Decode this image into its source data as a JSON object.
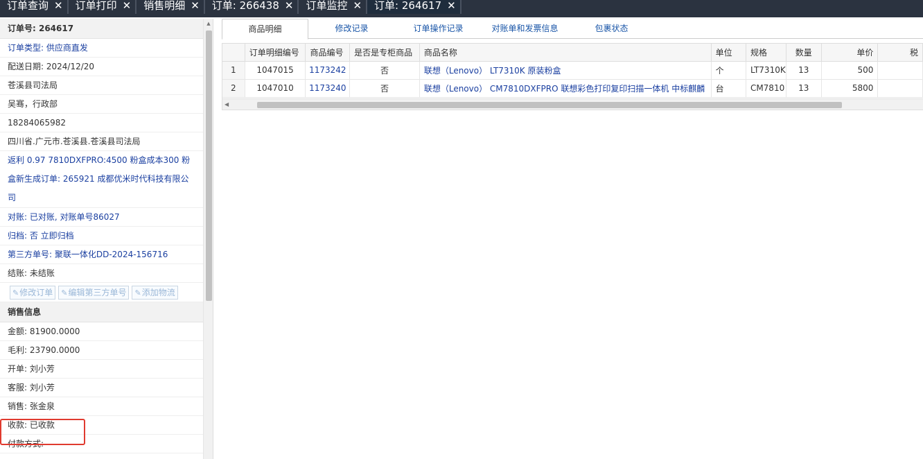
{
  "top_tabs": [
    {
      "label": "订单查询"
    },
    {
      "label": "订单打印"
    },
    {
      "label": "销售明细"
    },
    {
      "label": "订单: 266438"
    },
    {
      "label": "订单监控"
    },
    {
      "label": "订单: 264617"
    }
  ],
  "close_glyph": "✕",
  "order": {
    "header": "订单号: 264617",
    "type": "订单类型: 供应商直发",
    "delivery_date": "配送日期: 2024/12/20",
    "customer": "苍溪县司法局",
    "contact": "吴骞，行政部",
    "phone": "18284065982",
    "address": "四川省.广元市.苍溪县.苍溪县司法局",
    "remark": "返利 0.97 7810DXFPRO:4500 粉盒成本300 粉盒新生成订单: 265921 成都优米时代科技有限公司",
    "reconcile": "对账: 已对账, 对账单号86027",
    "archive": "归档: 否 立即归档",
    "third_party": "第三方单号: 聚联一体化DD-2024-156716",
    "settle": "结账: 未结账",
    "buttons": {
      "edit_order": "修改订单",
      "edit_third": "编辑第三方单号",
      "add_logistics": "添加物流"
    }
  },
  "sales": {
    "header": "销售信息",
    "amount": "金额: 81900.0000",
    "profit": "毛利: 23790.0000",
    "opener": "开单: 刘小芳",
    "service": "客服: 刘小芳",
    "salesman": "销售: 张金泉",
    "payment_status": "收款: 已收款",
    "payment_method": "付款方式:"
  },
  "sub_tabs": [
    "商品明细",
    "修改记录",
    "订单操作记录",
    "对账单和发票信息",
    "包裹状态"
  ],
  "table": {
    "headers": [
      "订单明细编号",
      "商品编号",
      "是否是专柜商品",
      "商品名称",
      "单位",
      "规格",
      "数量",
      "单价",
      "税"
    ],
    "rows": [
      {
        "idx": "1",
        "detail_id": "1047015",
        "sku": "1173242",
        "counter": "否",
        "name": "联想（Lenovo） LT7310K 原装粉盒",
        "unit": "个",
        "spec": "LT7310K",
        "qty": "13",
        "price": "500"
      },
      {
        "idx": "2",
        "detail_id": "1047010",
        "sku": "1173240",
        "counter": "否",
        "name": "联想（Lenovo） CM7810DXFPRO 联想彩色打印复印扫描一体机 中标麒麟",
        "unit": "台",
        "spec": "CM7810",
        "qty": "13",
        "price": "5800"
      }
    ]
  }
}
